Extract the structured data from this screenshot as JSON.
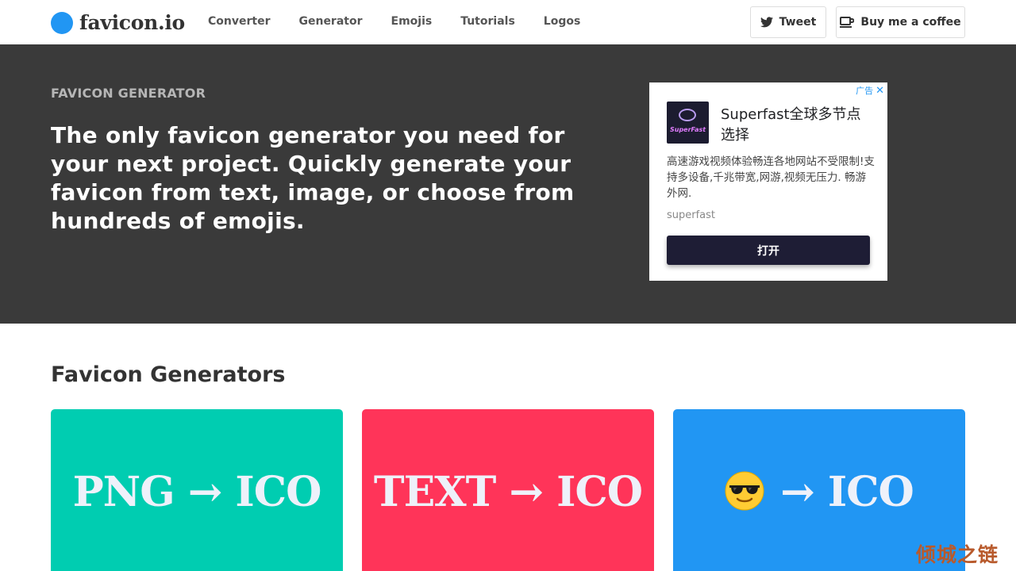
{
  "header": {
    "logo_text": "favicon.io",
    "nav": [
      "Converter",
      "Generator",
      "Emojis",
      "Tutorials",
      "Logos"
    ],
    "tweet_label": "Tweet",
    "coffee_label": "Buy me a coffee"
  },
  "hero": {
    "eyebrow": "FAVICON GENERATOR",
    "headline": "The only favicon generator you need for your next project. Quickly generate your favicon from text, image, or choose from hundreds of emojis.",
    "background_color": "#3a3a3a"
  },
  "ad": {
    "marker": "广告",
    "close_glyph": "✕",
    "logo_text": "SuperFast",
    "title": "Superfast全球多节点选择",
    "description": "高速游戏视频体验畅连各地网站不受限制!支持多设备,千兆带宽,网游,视频无压力. 畅游外网.",
    "domain": "superfast",
    "cta": "打开"
  },
  "generators": {
    "title": "Favicon Generators",
    "cards": [
      {
        "label": "PNG → ICO",
        "color": "#00cdb1"
      },
      {
        "label": "TEXT → ICO",
        "color": "#ff3459"
      },
      {
        "label": "→ ICO",
        "emoji": "smiling-face-with-sunglasses",
        "color": "#2196f3"
      }
    ]
  },
  "watermark": "倾城之链",
  "colors": {
    "brand_blue": "#2196f3",
    "text_dark": "#333333"
  }
}
